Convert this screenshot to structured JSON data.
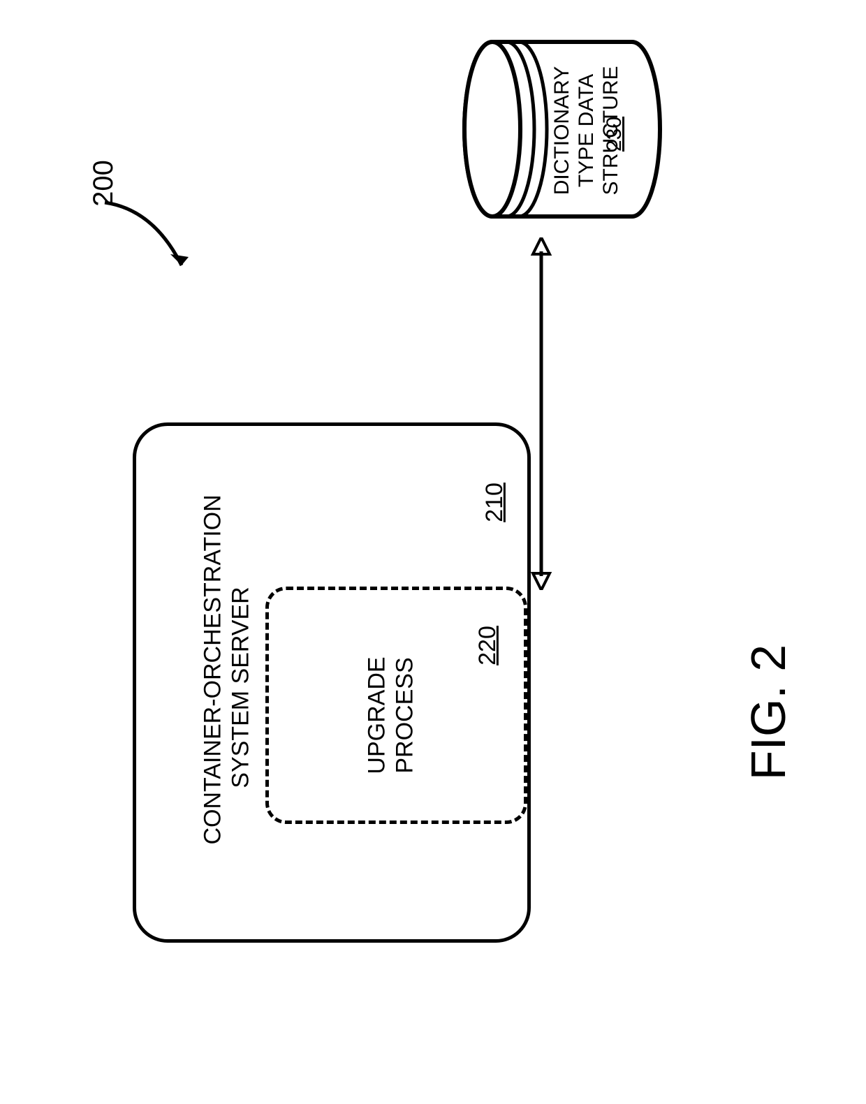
{
  "figure_ref": "200",
  "figure_label": "FIG. 2",
  "server": {
    "title_line1": "CONTAINER-ORCHESTRATION",
    "title_line2": "SYSTEM SERVER",
    "ref": "210"
  },
  "process": {
    "title_line1": "UPGRADE",
    "title_line2": "PROCESS",
    "ref": "220"
  },
  "datastore": {
    "title_line1": "DICTIONARY",
    "title_line2": "TYPE DATA",
    "title_line3": "STRUCTURE",
    "ref": "230"
  }
}
